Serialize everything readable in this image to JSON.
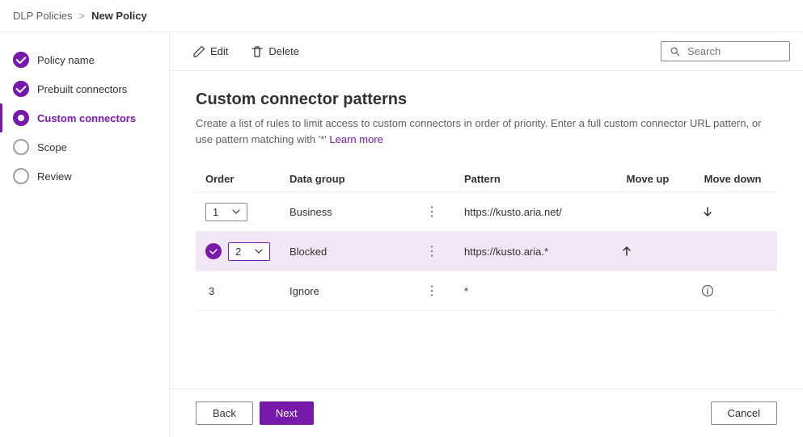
{
  "breadcrumb": {
    "parent": "DLP Policies",
    "separator": ">",
    "current": "New Policy"
  },
  "sidebar": {
    "items": [
      {
        "id": "policy-name",
        "label": "Policy name",
        "state": "done"
      },
      {
        "id": "prebuilt-connectors",
        "label": "Prebuilt connectors",
        "state": "done"
      },
      {
        "id": "custom-connectors",
        "label": "Custom connectors",
        "state": "active"
      },
      {
        "id": "scope",
        "label": "Scope",
        "state": "empty"
      },
      {
        "id": "review",
        "label": "Review",
        "state": "empty"
      }
    ]
  },
  "toolbar": {
    "edit_label": "Edit",
    "delete_label": "Delete",
    "search_placeholder": "Search"
  },
  "content": {
    "title": "Custom connector patterns",
    "description": "Create a list of rules to limit access to custom connectors in order of priority. Enter a full custom connector URL pattern, or use pattern matching with '*'",
    "learn_more": "Learn more",
    "table": {
      "columns": [
        "Order",
        "Data group",
        "",
        "Pattern",
        "Move up",
        "Move down"
      ],
      "rows": [
        {
          "order": "1",
          "datagroup": "Business",
          "pattern": "https://kusto.aria.net/",
          "has_move_up": false,
          "has_move_down": true,
          "has_check": false,
          "highlighted": false
        },
        {
          "order": "2",
          "datagroup": "Blocked",
          "pattern": "https://kusto.aria.*",
          "has_move_up": true,
          "has_move_down": false,
          "has_check": true,
          "highlighted": true
        },
        {
          "order": "3",
          "datagroup": "Ignore",
          "pattern": "*",
          "has_move_up": false,
          "has_move_down": false,
          "has_check": false,
          "highlighted": false,
          "has_info": true
        }
      ]
    }
  },
  "footer": {
    "back_label": "Back",
    "next_label": "Next",
    "cancel_label": "Cancel"
  },
  "icons": {
    "check": "✓",
    "arrow_down": "↓",
    "arrow_up": "↑",
    "chevron_down": "⌄",
    "dots": "⋮",
    "info": "ℹ",
    "search": "🔍",
    "pencil": "✏",
    "trash": "🗑"
  }
}
